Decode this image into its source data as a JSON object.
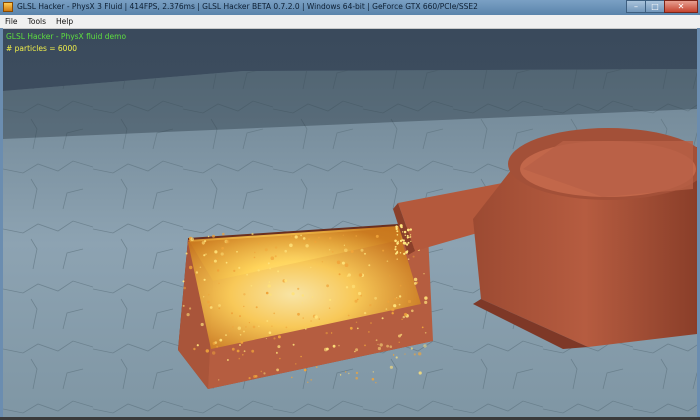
{
  "window": {
    "title": "GLSL Hacker - PhysX 3 Fluid | 414FPS, 2.376ms | GLSL Hacker BETA 0.7.2.0 | Windows 64-bit | GeForce GTX 660/PCIe/SSE2",
    "minimize_glyph": "–",
    "maximize_glyph": "□",
    "close_glyph": "✕"
  },
  "menu": {
    "items": [
      {
        "label": "File"
      },
      {
        "label": "Tools"
      },
      {
        "label": "Help"
      }
    ]
  },
  "overlay": {
    "demo_title": "GLSL Hacker - PhysX fluid demo",
    "particle_count": "# particles = 6000"
  },
  "colors": {
    "overlay_title": "#5dde3f",
    "overlay_count": "#f2f04a",
    "container": "#b05a3e",
    "particles": "#ffd15a",
    "ground": "#8fa7b6"
  },
  "icons": {
    "app": "app-icon",
    "minimize": "minimize-icon",
    "maximize": "maximize-icon",
    "close": "close-icon"
  }
}
